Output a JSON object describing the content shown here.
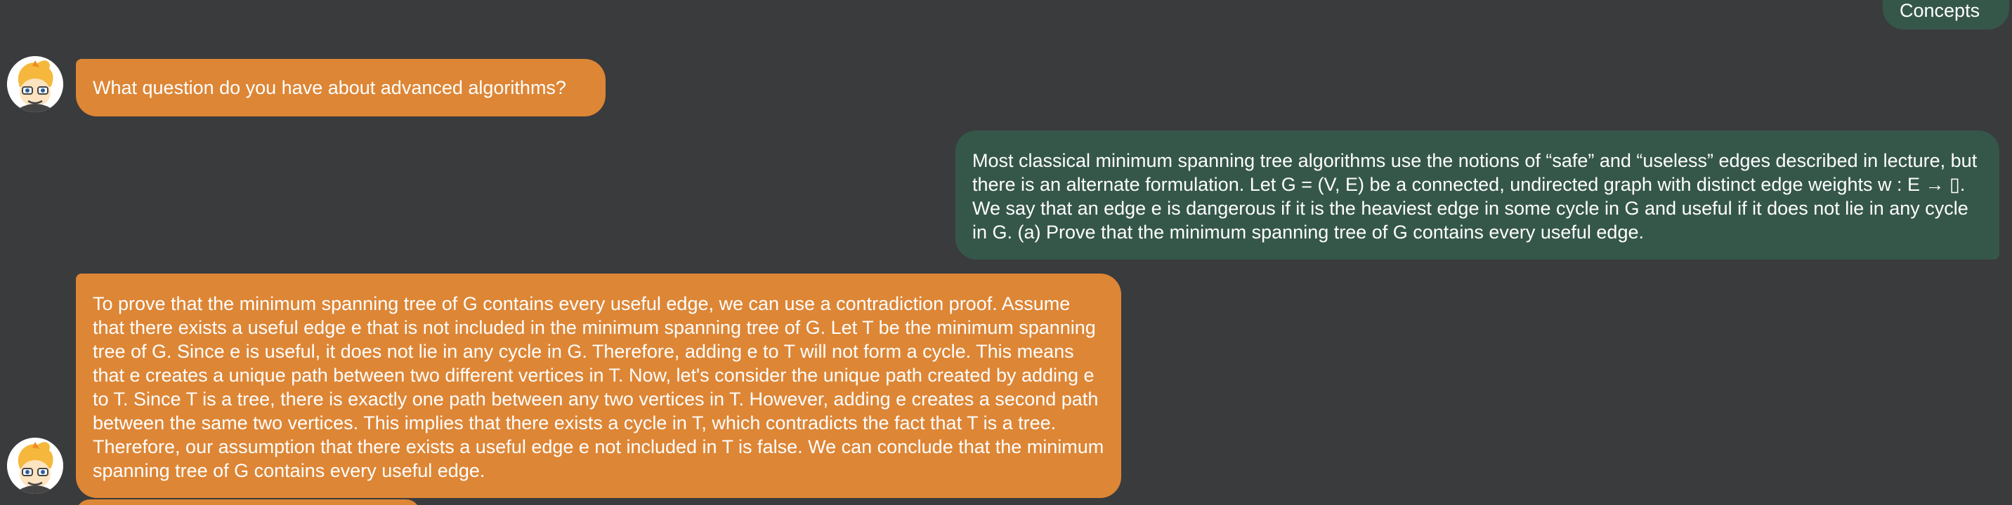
{
  "conversation": {
    "top_user_partial": "Concepts",
    "bot_greeting": "What question do you have about advanced algorithms?",
    "user_question": "Most classical minimum spanning tree algorithms use the notions of “safe” and “useless” edges described in lecture, but there is an alternate formulation. Let G = (V, E) be a connected, undirected graph with distinct edge weights w : E → ▯. We say that an edge e is dangerous if it is the heaviest edge in some cycle in G and useful if it does not lie in any cycle in G. (a) Prove that the minimum spanning tree of G contains every useful edge.",
    "bot_answer": "To prove that the minimum spanning tree of G contains every useful edge, we can use a contradiction proof. Assume that there exists a useful edge e that is not included in the minimum spanning tree of G. Let T be the minimum spanning tree of G. Since e is useful, it does not lie in any cycle in G. Therefore, adding e to T will not form a cycle. This means that e creates a unique path between two different vertices in T. Now, let's consider the unique path created by adding e to T. Since T is a tree, there is exactly one path between any two vertices in T. However, adding e creates a second path between the same two vertices. This implies that there exists a cycle in T, which contradicts the fact that T is a tree. Therefore, our assumption that there exists a useful edge e not included in T is false. We can conclude that the minimum spanning tree of G contains every useful edge."
  },
  "icons": {
    "avatar": "cartoon-fox-avatar-icon"
  },
  "colors": {
    "background": "#3a3b3d",
    "bot_bubble": "#dd8636",
    "user_bubble": "#35574a",
    "text": "#ffffff"
  }
}
